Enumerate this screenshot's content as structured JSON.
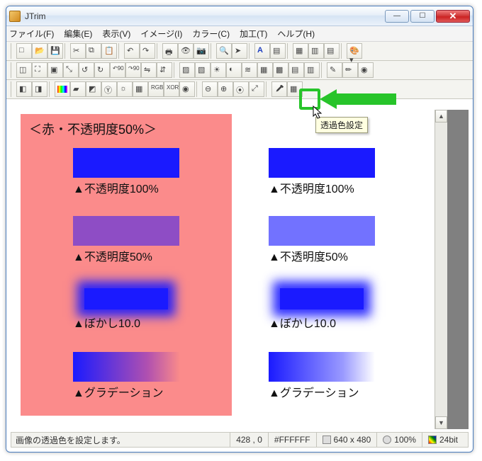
{
  "title": "JTrim",
  "menus": [
    "ファイル(F)",
    "編集(E)",
    "表示(V)",
    "イメージ(I)",
    "カラー(C)",
    "加工(T)",
    "ヘルプ(H)"
  ],
  "tooltip": "透過色設定",
  "canvas": {
    "heading": "＜赤・不透明度50%＞",
    "left": [
      {
        "label": "▲不透明度100%"
      },
      {
        "label": "▲不透明度50%"
      },
      {
        "label": "▲ぼかし10.0"
      },
      {
        "label": "▲グラデーション"
      }
    ],
    "right": [
      {
        "label": "▲不透明度100%"
      },
      {
        "label": "▲不透明度50%"
      },
      {
        "label": "▲ぼかし10.0"
      },
      {
        "label": "▲グラデーション"
      }
    ]
  },
  "status": {
    "msg": "画像の透過色を設定します。",
    "coords": "428 , 0",
    "color": "#FFFFFF",
    "dims": "640 x 480",
    "zoom": "100%",
    "depth": "24bit"
  },
  "icons": {
    "new": "□",
    "open": "📂",
    "save": "💾",
    "separator": "",
    "undo": "↶",
    "redo": "↷",
    "cut": "✂",
    "copy": "⧉",
    "paste": "📋",
    "find": "🔍",
    "crop": "◫",
    "resize": "⛶",
    "fit": "▣",
    "rot-l": "↺",
    "rot-r": "↻",
    "rot-90l": "↶90",
    "rot-90r": "↷90",
    "flip-h": "⇋",
    "flip-v": "⇵",
    "bright": "☀",
    "contrast": "◐",
    "sepia": "▤",
    "wave": "≋",
    "chk": "▦",
    "text": "A",
    "color": "🎨",
    "eyedrop": "⌯",
    "zoom-in": "⊕",
    "zoom-out": "⊖",
    "zoom-fit": "⤢",
    "zoom-100": "①",
    "grid": "▦",
    "misc": "◧"
  }
}
